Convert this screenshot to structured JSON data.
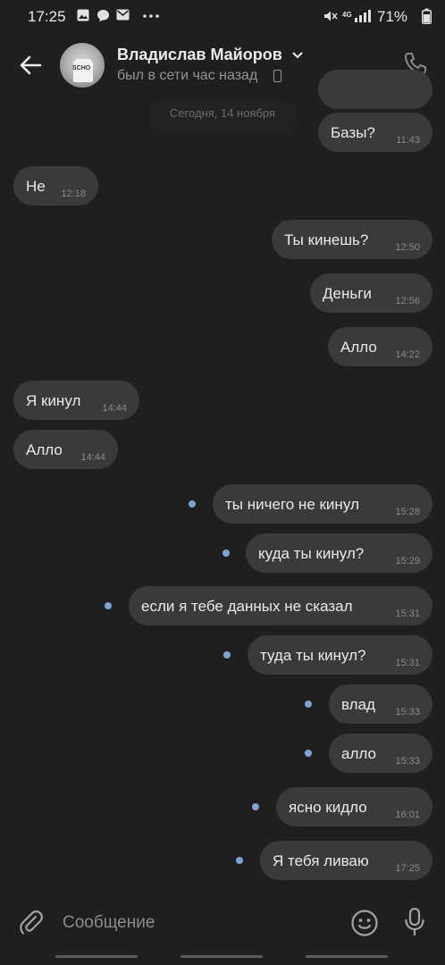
{
  "status_bar": {
    "time": "17:25",
    "battery": "71%",
    "network": "4G",
    "icons": [
      "gallery-icon",
      "chat-icon",
      "mail-icon",
      "more-icon",
      "mute-icon",
      "signal-icon",
      "battery-icon"
    ]
  },
  "header": {
    "name": "Владислав Майоров",
    "status": "был в сети час назад"
  },
  "chat": {
    "date_chip": "Сегодня, 14 ноября",
    "messages": [
      {
        "text": "Базы?",
        "time": "11:43",
        "side": "out",
        "unread": false
      },
      {
        "text": "Не",
        "time": "12:18",
        "side": "in",
        "unread": false
      },
      {
        "text": "Ты кинешь?",
        "time": "12:50",
        "side": "out",
        "unread": false
      },
      {
        "text": "Деньги",
        "time": "12:56",
        "side": "out",
        "unread": false
      },
      {
        "text": "Алло",
        "time": "14:22",
        "side": "out",
        "unread": false
      },
      {
        "text": "Я кинул",
        "time": "14:44",
        "side": "in",
        "unread": false
      },
      {
        "text": "Алло",
        "time": "14:44",
        "side": "in",
        "unread": false
      },
      {
        "text": "ты ничего не кинул",
        "time": "15:28",
        "side": "out",
        "unread": true
      },
      {
        "text": "куда ты кинул?",
        "time": "15:29",
        "side": "out",
        "unread": true
      },
      {
        "text": "если я тебе данных не сказал",
        "time": "15:31",
        "side": "out",
        "unread": true
      },
      {
        "text": "туда ты кинул?",
        "time": "15:31",
        "side": "out",
        "unread": true
      },
      {
        "text": "влад",
        "time": "15:33",
        "side": "out",
        "unread": true
      },
      {
        "text": "алло",
        "time": "15:33",
        "side": "out",
        "unread": true
      },
      {
        "text": "ясно кидло",
        "time": "16:01",
        "side": "out",
        "unread": true
      },
      {
        "text": "Я тебя ливаю",
        "time": "17:25",
        "side": "out",
        "unread": true
      }
    ]
  },
  "input": {
    "placeholder": "Сообщение"
  },
  "colors": {
    "background": "#1f1f1f",
    "bubble": "#3a3a3a",
    "unread_dot": "#7da4d8"
  }
}
